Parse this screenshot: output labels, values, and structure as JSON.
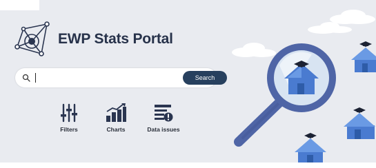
{
  "portal": {
    "title": "EWP Stats Portal",
    "logo_icon": "network-logo-icon"
  },
  "search": {
    "placeholder": "",
    "value": "",
    "button_label": "Search",
    "icon": "search-icon"
  },
  "tools": [
    {
      "label": "Filters",
      "icon": "sliders-icon"
    },
    {
      "label": "Charts",
      "icon": "bar-chart-icon"
    },
    {
      "label": "Data issues",
      "icon": "data-issues-icon"
    }
  ],
  "colors": {
    "banner_bg": "#e9ebf0",
    "title_text": "#27324a",
    "search_button": "#27405e",
    "magnifier": "#4f65a6",
    "house_blue": "#4a7bd0"
  }
}
